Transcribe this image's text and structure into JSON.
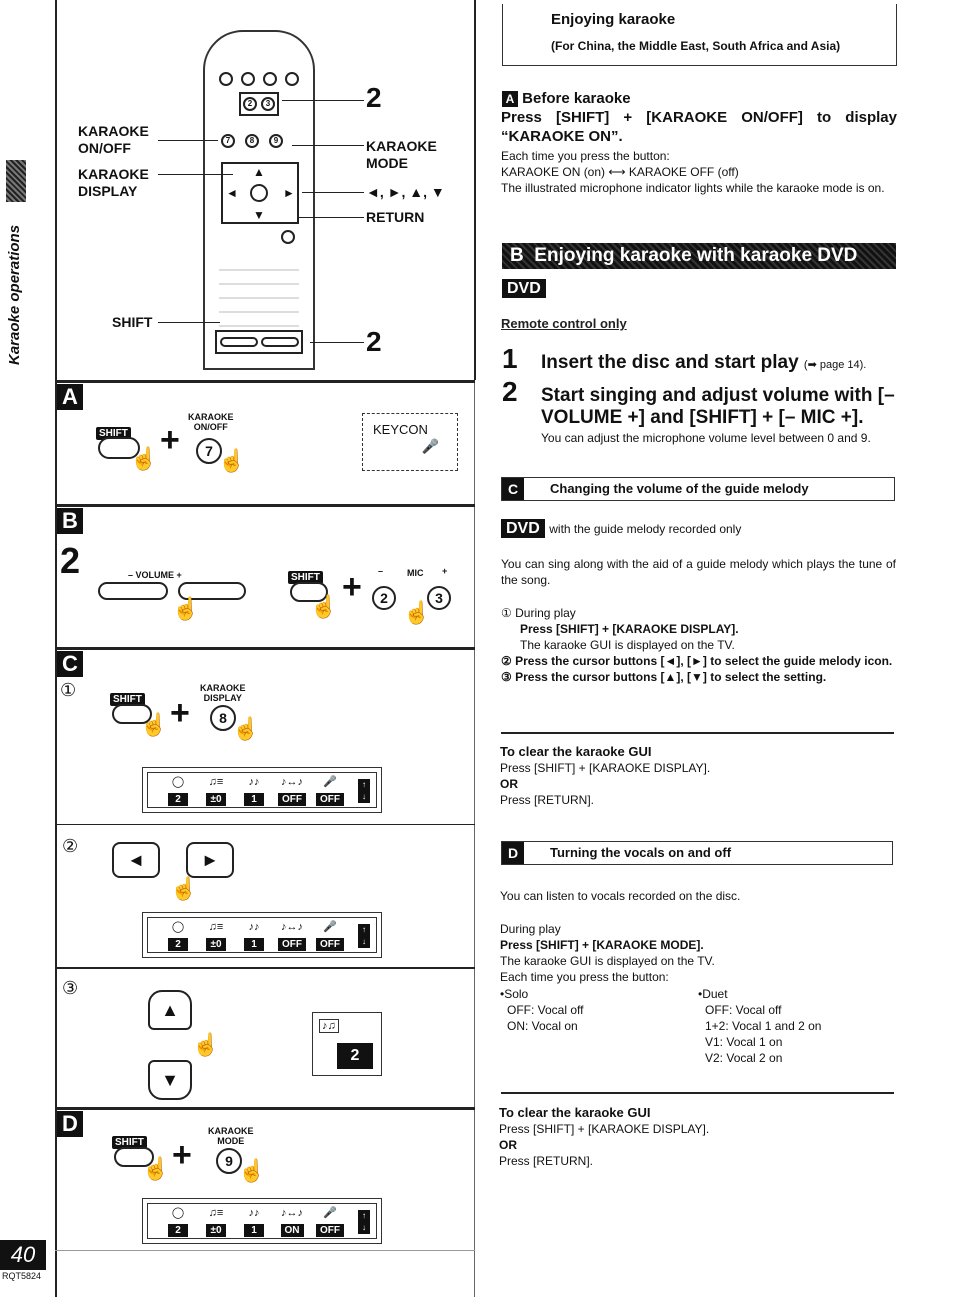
{
  "side": {
    "section_title": "Karaoke operations",
    "page_number": "40",
    "doc_code": "RQT5824"
  },
  "remote_diagram": {
    "labels": {
      "karaoke_on_off": [
        "KARAOKE",
        "ON/OFF"
      ],
      "karaoke_display": [
        "KARAOKE",
        "DISPLAY"
      ],
      "karaoke_mode": [
        "KARAOKE",
        "MODE"
      ],
      "cursor": "◄, ►, ▲, ▼",
      "return": "RETURN",
      "shift": "SHIFT",
      "step_top": "2",
      "step_bottom": "2"
    },
    "remote_keys": {
      "mic_minus": "2",
      "mic_plus": "3",
      "k7": "7",
      "k8": "8",
      "k9": "9",
      "volume": "– VOLUME +"
    }
  },
  "panel_a": {
    "letter": "A",
    "shift": "SHIFT",
    "key_label": [
      "KARAOKE",
      "ON/OFF"
    ],
    "key": "7",
    "plus": "+",
    "screen_text": "KEYCON"
  },
  "panel_b": {
    "letter": "B",
    "step": "2",
    "volume_label": "–   VOLUME   +",
    "shift": "SHIFT",
    "plus": "+",
    "mic_minus": "–",
    "mic_label": "MIC",
    "mic_plus": "+",
    "key_minus": "2",
    "key_plus": "3"
  },
  "panel_c": {
    "letter": "C",
    "step1": {
      "marker": "①",
      "shift": "SHIFT",
      "key_label": [
        "KARAOKE",
        "DISPLAY"
      ],
      "key": "8",
      "plus": "+",
      "gui_values": [
        "2",
        "±0",
        "1",
        "OFF",
        "OFF"
      ]
    },
    "step2": {
      "marker": "②",
      "left_key": "◄",
      "right_key": "►",
      "gui_values": [
        "2",
        "±0",
        "1",
        "OFF",
        "OFF"
      ]
    },
    "step3": {
      "marker": "③",
      "up_key": "▲",
      "down_key": "▼",
      "gui_value": "2"
    }
  },
  "panel_d": {
    "letter": "D",
    "shift": "SHIFT",
    "key_label": [
      "KARAOKE",
      "MODE"
    ],
    "key": "9",
    "plus": "+",
    "gui_values": [
      "2",
      "±0",
      "1",
      "ON",
      "OFF"
    ]
  },
  "gui_icons": [
    "guide-melody-icon",
    "key-control-icon",
    "vocal-icon",
    "duet-icon",
    "mic-icon",
    "scroll-icon"
  ],
  "right": {
    "title": "Enjoying karaoke",
    "subtitle": "(For China, the Middle East, South Africa and Asia)",
    "section_a": {
      "letter": "A",
      "heading": "Before karaoke",
      "instruction": "Press [SHIFT] + [KARAOKE ON/OFF] to display “KARAOKE ON”.",
      "lines": [
        "Each time you press the button:",
        "KARAOKE ON (on) ⟷ KARAOKE OFF (off)",
        "The illustrated microphone indicator lights while the karaoke mode is on."
      ]
    },
    "section_b": {
      "letter": "B",
      "banner": "Enjoying karaoke with karaoke DVD",
      "badge": "DVD",
      "remote_note": "Remote control only",
      "steps": [
        {
          "num": "1",
          "text": "Insert the disc and start play",
          "ref": "(➡ page 14)."
        },
        {
          "num": "2",
          "text": "Start singing and adjust volume with [– VOLUME +] and [SHIFT] + [– MIC +].",
          "note": "You can adjust the microphone volume level between 0 and 9."
        }
      ]
    },
    "section_c": {
      "letter": "C",
      "heading": "Changing the volume of the guide melody",
      "badge": "DVD",
      "badge_note": "with the guide melody recorded only",
      "intro": "You can sing along with the aid of a guide melody which plays the tune of the song.",
      "steps": [
        {
          "marker": "①",
          "lines": [
            "During play"
          ],
          "bold": "Press [SHIFT] + [KARAOKE DISPLAY].",
          "after": "The karaoke GUI is displayed on the TV."
        },
        {
          "marker": "②",
          "bold": "Press the cursor buttons [◄], [►] to select the guide melody icon."
        },
        {
          "marker": "③",
          "bold": "Press the cursor buttons [▲], [▼] to select the setting."
        }
      ],
      "clear": {
        "heading": "To clear the karaoke GUI",
        "line1": "Press [SHIFT] + [KARAOKE DISPLAY].",
        "or": "OR",
        "line2": "Press [RETURN]."
      }
    },
    "section_d": {
      "letter": "D",
      "heading": "Turning the vocals on and off",
      "intro": "You can listen to vocals recorded on the disc.",
      "during": "During play",
      "bold": "Press [SHIFT] + [KARAOKE MODE].",
      "after": "The karaoke GUI is displayed on the TV.",
      "each_time": "Each time you press the button:",
      "solo": {
        "title": "•Solo",
        "items": [
          "OFF:  Vocal off",
          "ON:  Vocal on"
        ]
      },
      "duet": {
        "title": "•Duet",
        "items": [
          "OFF:  Vocal off",
          "1+2:  Vocal 1 and 2 on",
          "V1:  Vocal 1 on",
          "V2:  Vocal 2 on"
        ]
      },
      "clear": {
        "heading": "To clear the karaoke GUI",
        "line1": "Press [SHIFT] + [KARAOKE DISPLAY].",
        "or": "OR",
        "line2": "Press [RETURN]."
      }
    }
  }
}
